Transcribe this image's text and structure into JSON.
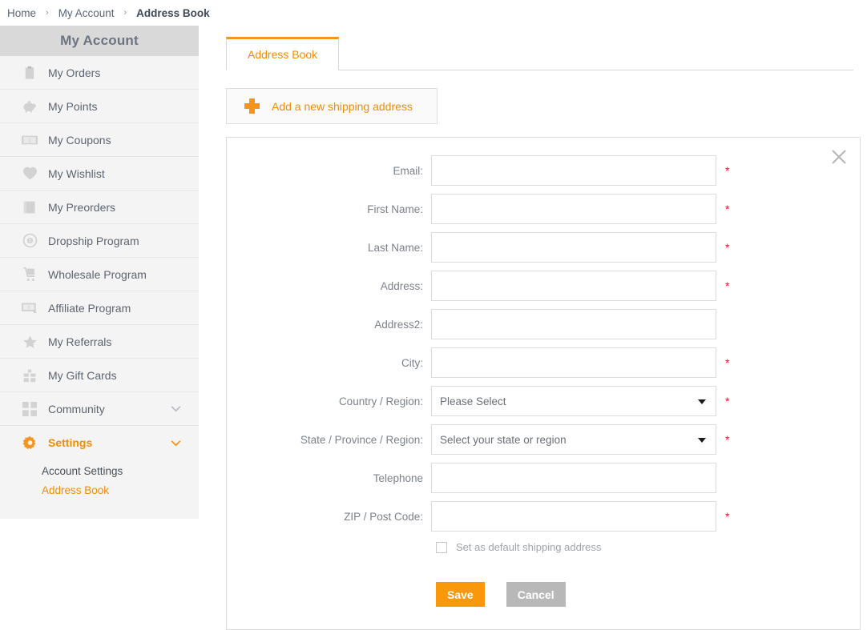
{
  "breadcrumb": {
    "separator": "›",
    "items": [
      {
        "label": "Home",
        "current": false
      },
      {
        "label": "My Account",
        "current": false
      },
      {
        "label": "Address Book",
        "current": true
      }
    ]
  },
  "sidebar": {
    "title": "My Account",
    "items": [
      {
        "label": "My Orders",
        "icon": "clipboard-icon",
        "chevron": "",
        "active": false
      },
      {
        "label": "My Points",
        "icon": "piggy-bank-icon",
        "chevron": "",
        "active": false
      },
      {
        "label": "My Coupons",
        "icon": "coupon-icon",
        "chevron": "",
        "active": false
      },
      {
        "label": "My Wishlist",
        "icon": "heart-icon",
        "chevron": "",
        "active": false
      },
      {
        "label": "My Preorders",
        "icon": "book-icon",
        "chevron": "",
        "active": false
      },
      {
        "label": "Dropship Program",
        "icon": "dollar-circle-icon",
        "chevron": "",
        "active": false
      },
      {
        "label": "Wholesale Program",
        "icon": "shopping-cart-icon",
        "chevron": "",
        "active": false
      },
      {
        "label": "Affiliate Program",
        "icon": "banknote-icon",
        "chevron": "",
        "active": false
      },
      {
        "label": "My Referrals",
        "icon": "star-icon",
        "chevron": "",
        "active": false
      },
      {
        "label": "My Gift Cards",
        "icon": "gift-icon",
        "chevron": "",
        "active": false
      },
      {
        "label": "Community",
        "icon": "grid-icon",
        "chevron": "⌄",
        "active": false
      },
      {
        "label": "Settings",
        "icon": "gear-icon",
        "chevron": "⌄",
        "active": true
      }
    ],
    "subitems": [
      {
        "label": "Account Settings",
        "active": false
      },
      {
        "label": "Address Book",
        "active": true
      }
    ]
  },
  "main": {
    "tab_label": "Address Book",
    "add_address_label": "Add a new shipping address",
    "form": {
      "close_label": "✕",
      "fields": [
        {
          "label": "Email:",
          "type": "text",
          "value": "",
          "placeholder": "",
          "required": true
        },
        {
          "label": "First Name:",
          "type": "text",
          "value": "",
          "placeholder": "",
          "required": true
        },
        {
          "label": "Last Name:",
          "type": "text",
          "value": "",
          "placeholder": "",
          "required": true
        },
        {
          "label": "Address:",
          "type": "text",
          "value": "",
          "placeholder": "",
          "required": true
        },
        {
          "label": "Address2:",
          "type": "text",
          "value": "",
          "placeholder": "",
          "required": false
        },
        {
          "label": "City:",
          "type": "text",
          "value": "",
          "placeholder": "",
          "required": true
        },
        {
          "label": "Country / Region:",
          "type": "select",
          "value": "Please Select",
          "placeholder": "",
          "required": true
        },
        {
          "label": "State / Province / Region:",
          "type": "select",
          "value": "Select your state or region",
          "placeholder": "",
          "required": true
        },
        {
          "label": "Telephone",
          "type": "text",
          "value": "",
          "placeholder": "",
          "required": false
        },
        {
          "label": "ZIP / Post Code:",
          "type": "text",
          "value": "",
          "placeholder": "",
          "required": true
        }
      ],
      "default_checkbox_label": "Set as default shipping address",
      "default_checkbox_checked": false,
      "save_label": "Save",
      "cancel_label": "Cancel",
      "required_marker": "*"
    }
  },
  "colors": {
    "accent_orange": "#f7941d",
    "link_orange": "#f18d00",
    "save_button": "#f9980a",
    "cancel_button": "#b8b8b8",
    "required_red": "#d3202a",
    "sidebar_bg": "#f4f4f4",
    "sidebar_header_bg": "#d9d9d9"
  }
}
